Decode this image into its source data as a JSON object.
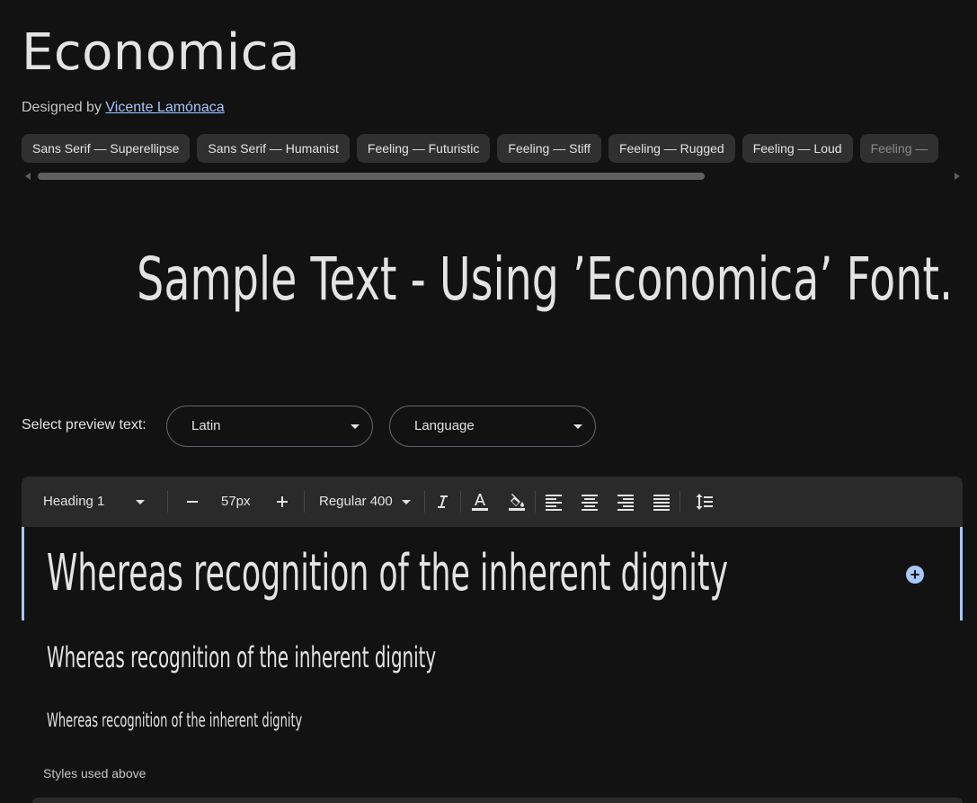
{
  "font": {
    "name": "Economica",
    "designed_by_prefix": "Designed by",
    "designer": "Vicente Lamónaca"
  },
  "tags": [
    "Sans Serif — Superellipse",
    "Sans Serif — Humanist",
    "Feeling — Futuristic",
    "Feeling — Stiff",
    "Feeling — Rugged",
    "Feeling — Loud",
    "Feeling —"
  ],
  "sample": {
    "text": "Sample Text - Using ’Economica’ Font."
  },
  "preview": {
    "label": "Select preview text:",
    "script_value": "Latin",
    "language_value": "Language"
  },
  "toolbar": {
    "style_value": "Heading 1",
    "size_value": "57px",
    "weight_value": "Regular 400"
  },
  "editor": {
    "line1": "Whereas recognition of the inherent dignity",
    "line2": "Whereas recognition of the inherent dignity",
    "line3": "Whereas recognition of the inherent dignity"
  },
  "styles_label": "Styles used above",
  "colors": {
    "background": "#121212",
    "accent": "#a8c7fa",
    "chip": "#303030",
    "toolbar": "#2a2a2a"
  }
}
